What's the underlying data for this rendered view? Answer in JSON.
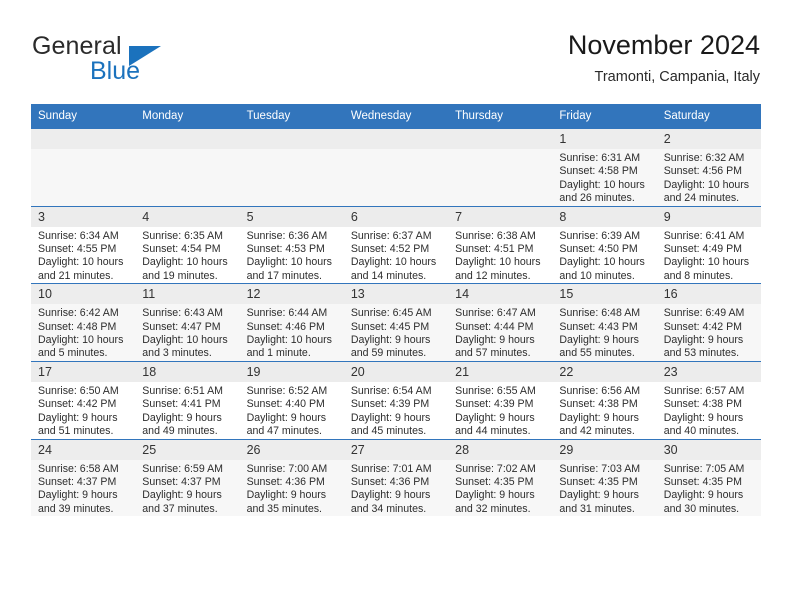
{
  "brand": {
    "word_one": "General",
    "word_two": "Blue",
    "accent_color": "#1b72bd",
    "triangle_icon": "brand-triangle-icon"
  },
  "header": {
    "title": "November 2024",
    "subtitle": "Tramonti, Campania, Italy"
  },
  "theme": {
    "header_blue": "#3275bc",
    "row_divider": "#3275bc",
    "daynum_band": "#ececec",
    "shaded_row": "#f7f7f7"
  },
  "calendar": {
    "weekday_headers": [
      "Sunday",
      "Monday",
      "Tuesday",
      "Wednesday",
      "Thursday",
      "Friday",
      "Saturday"
    ],
    "weeks": [
      [
        {
          "day": "",
          "lines": []
        },
        {
          "day": "",
          "lines": []
        },
        {
          "day": "",
          "lines": []
        },
        {
          "day": "",
          "lines": []
        },
        {
          "day": "",
          "lines": []
        },
        {
          "day": "1",
          "lines": [
            "Sunrise: 6:31 AM",
            "Sunset: 4:58 PM",
            "Daylight: 10 hours",
            "and 26 minutes."
          ]
        },
        {
          "day": "2",
          "lines": [
            "Sunrise: 6:32 AM",
            "Sunset: 4:56 PM",
            "Daylight: 10 hours",
            "and 24 minutes."
          ]
        }
      ],
      [
        {
          "day": "3",
          "lines": [
            "Sunrise: 6:34 AM",
            "Sunset: 4:55 PM",
            "Daylight: 10 hours",
            "and 21 minutes."
          ]
        },
        {
          "day": "4",
          "lines": [
            "Sunrise: 6:35 AM",
            "Sunset: 4:54 PM",
            "Daylight: 10 hours",
            "and 19 minutes."
          ]
        },
        {
          "day": "5",
          "lines": [
            "Sunrise: 6:36 AM",
            "Sunset: 4:53 PM",
            "Daylight: 10 hours",
            "and 17 minutes."
          ]
        },
        {
          "day": "6",
          "lines": [
            "Sunrise: 6:37 AM",
            "Sunset: 4:52 PM",
            "Daylight: 10 hours",
            "and 14 minutes."
          ]
        },
        {
          "day": "7",
          "lines": [
            "Sunrise: 6:38 AM",
            "Sunset: 4:51 PM",
            "Daylight: 10 hours",
            "and 12 minutes."
          ]
        },
        {
          "day": "8",
          "lines": [
            "Sunrise: 6:39 AM",
            "Sunset: 4:50 PM",
            "Daylight: 10 hours",
            "and 10 minutes."
          ]
        },
        {
          "day": "9",
          "lines": [
            "Sunrise: 6:41 AM",
            "Sunset: 4:49 PM",
            "Daylight: 10 hours",
            "and 8 minutes."
          ]
        }
      ],
      [
        {
          "day": "10",
          "lines": [
            "Sunrise: 6:42 AM",
            "Sunset: 4:48 PM",
            "Daylight: 10 hours",
            "and 5 minutes."
          ]
        },
        {
          "day": "11",
          "lines": [
            "Sunrise: 6:43 AM",
            "Sunset: 4:47 PM",
            "Daylight: 10 hours",
            "and 3 minutes."
          ]
        },
        {
          "day": "12",
          "lines": [
            "Sunrise: 6:44 AM",
            "Sunset: 4:46 PM",
            "Daylight: 10 hours",
            "and 1 minute."
          ]
        },
        {
          "day": "13",
          "lines": [
            "Sunrise: 6:45 AM",
            "Sunset: 4:45 PM",
            "Daylight: 9 hours",
            "and 59 minutes."
          ]
        },
        {
          "day": "14",
          "lines": [
            "Sunrise: 6:47 AM",
            "Sunset: 4:44 PM",
            "Daylight: 9 hours",
            "and 57 minutes."
          ]
        },
        {
          "day": "15",
          "lines": [
            "Sunrise: 6:48 AM",
            "Sunset: 4:43 PM",
            "Daylight: 9 hours",
            "and 55 minutes."
          ]
        },
        {
          "day": "16",
          "lines": [
            "Sunrise: 6:49 AM",
            "Sunset: 4:42 PM",
            "Daylight: 9 hours",
            "and 53 minutes."
          ]
        }
      ],
      [
        {
          "day": "17",
          "lines": [
            "Sunrise: 6:50 AM",
            "Sunset: 4:42 PM",
            "Daylight: 9 hours",
            "and 51 minutes."
          ]
        },
        {
          "day": "18",
          "lines": [
            "Sunrise: 6:51 AM",
            "Sunset: 4:41 PM",
            "Daylight: 9 hours",
            "and 49 minutes."
          ]
        },
        {
          "day": "19",
          "lines": [
            "Sunrise: 6:52 AM",
            "Sunset: 4:40 PM",
            "Daylight: 9 hours",
            "and 47 minutes."
          ]
        },
        {
          "day": "20",
          "lines": [
            "Sunrise: 6:54 AM",
            "Sunset: 4:39 PM",
            "Daylight: 9 hours",
            "and 45 minutes."
          ]
        },
        {
          "day": "21",
          "lines": [
            "Sunrise: 6:55 AM",
            "Sunset: 4:39 PM",
            "Daylight: 9 hours",
            "and 44 minutes."
          ]
        },
        {
          "day": "22",
          "lines": [
            "Sunrise: 6:56 AM",
            "Sunset: 4:38 PM",
            "Daylight: 9 hours",
            "and 42 minutes."
          ]
        },
        {
          "day": "23",
          "lines": [
            "Sunrise: 6:57 AM",
            "Sunset: 4:38 PM",
            "Daylight: 9 hours",
            "and 40 minutes."
          ]
        }
      ],
      [
        {
          "day": "24",
          "lines": [
            "Sunrise: 6:58 AM",
            "Sunset: 4:37 PM",
            "Daylight: 9 hours",
            "and 39 minutes."
          ]
        },
        {
          "day": "25",
          "lines": [
            "Sunrise: 6:59 AM",
            "Sunset: 4:37 PM",
            "Daylight: 9 hours",
            "and 37 minutes."
          ]
        },
        {
          "day": "26",
          "lines": [
            "Sunrise: 7:00 AM",
            "Sunset: 4:36 PM",
            "Daylight: 9 hours",
            "and 35 minutes."
          ]
        },
        {
          "day": "27",
          "lines": [
            "Sunrise: 7:01 AM",
            "Sunset: 4:36 PM",
            "Daylight: 9 hours",
            "and 34 minutes."
          ]
        },
        {
          "day": "28",
          "lines": [
            "Sunrise: 7:02 AM",
            "Sunset: 4:35 PM",
            "Daylight: 9 hours",
            "and 32 minutes."
          ]
        },
        {
          "day": "29",
          "lines": [
            "Sunrise: 7:03 AM",
            "Sunset: 4:35 PM",
            "Daylight: 9 hours",
            "and 31 minutes."
          ]
        },
        {
          "day": "30",
          "lines": [
            "Sunrise: 7:05 AM",
            "Sunset: 4:35 PM",
            "Daylight: 9 hours",
            "and 30 minutes."
          ]
        }
      ]
    ]
  }
}
